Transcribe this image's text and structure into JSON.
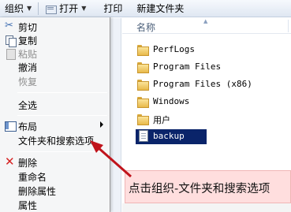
{
  "toolbar": {
    "organize_label": "组织",
    "open_label": "打开",
    "print_label": "打印",
    "new_folder_label": "新建文件夹"
  },
  "menu": {
    "items": [
      {
        "label": "剪切",
        "icon": "scissors-icon",
        "enabled": true
      },
      {
        "label": "复制",
        "icon": "copy-icon",
        "enabled": true
      },
      {
        "label": "粘贴",
        "icon": "paste-icon",
        "enabled": false
      },
      {
        "label": "撤消",
        "enabled": true
      },
      {
        "label": "恢复",
        "enabled": false
      },
      {
        "label": "全选",
        "enabled": true
      },
      {
        "label": "布局",
        "icon": "layout-icon",
        "enabled": true,
        "submenu": true
      },
      {
        "label": "文件夹和搜索选项",
        "enabled": true
      },
      {
        "label": "删除",
        "icon": "delete-icon",
        "enabled": true
      },
      {
        "label": "重命名",
        "enabled": true
      },
      {
        "label": "删除属性",
        "enabled": true
      },
      {
        "label": "属性",
        "enabled": true
      }
    ]
  },
  "file_list": {
    "column_name": "名称",
    "items": [
      {
        "name": "PerfLogs",
        "type": "folder"
      },
      {
        "name": "Program Files",
        "type": "folder"
      },
      {
        "name": "Program Files (x86)",
        "type": "folder"
      },
      {
        "name": "Windows",
        "type": "folder"
      },
      {
        "name": "用户",
        "type": "folder"
      },
      {
        "name": "backup",
        "type": "file",
        "selected": true
      }
    ]
  },
  "annotation": {
    "text": "点击组织-文件夹和搜索选项",
    "box_color": "#ffdede",
    "arrow_color": "#c0141c"
  },
  "colors": {
    "selection": "#0a246a",
    "menu_bg": "#f5f6f7",
    "toolbar_bg": "#dfe7f2"
  }
}
